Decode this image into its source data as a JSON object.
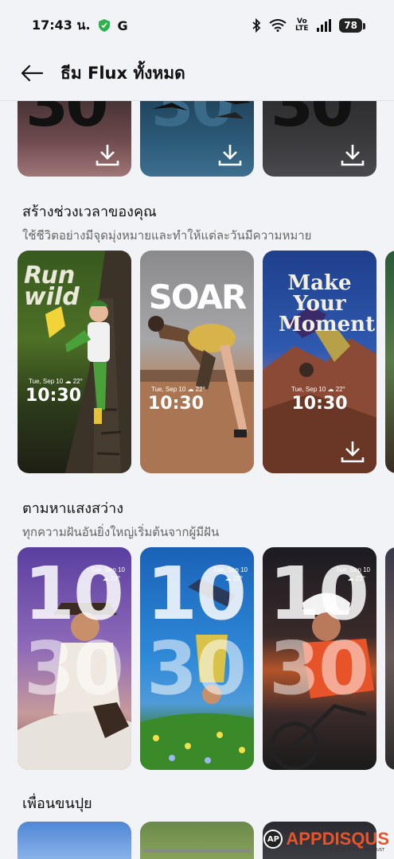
{
  "status": {
    "time": "17:43 น.",
    "g_letter": "G",
    "lte": "Vo LTE",
    "battery": "78"
  },
  "header": {
    "title": "ธีม Flux ทั้งหมด"
  },
  "top_row": {
    "digits": [
      "30",
      "30",
      "30"
    ]
  },
  "sections": [
    {
      "title": "สร้างช่วงเวลาของคุณ",
      "subtitle": "ใช้ชีวิตอย่างมีจุดมุ่งหมายและทำให้แต่ละวันมีความหมาย",
      "cards": [
        {
          "poster": "Run wild",
          "date": "Tue, Sep 10  ☁ 22°",
          "time": "10:30"
        },
        {
          "poster": "SOAR",
          "date": "Tue, Sep 10  ☁ 22°",
          "time": "10:30"
        },
        {
          "poster": "Make Your Moment",
          "date": "Tue, Sep 10  ☁ 22°",
          "time": "10:30"
        }
      ]
    },
    {
      "title": "ตามหาแสงสว่าง",
      "subtitle": "ทุกความฝันอันยิ่งใหญ่เริ่มต้นจากผู้มีฝัน",
      "cards": [
        {
          "date": "Tue, Sep 10",
          "temp": "☁ 22°",
          "hour": "10",
          "minute": "30"
        },
        {
          "date": "Tue, Sep 10",
          "temp": "☁ 22°",
          "hour": "10",
          "minute": "30"
        },
        {
          "date": "Tue, Sep 10",
          "temp": "☁ 22°",
          "hour": "10",
          "minute": "30"
        }
      ]
    },
    {
      "title": "เพื่อนขนปุย"
    }
  ],
  "watermark": {
    "logo": "AP",
    "brand": "APPDISQUS",
    "tagline": "A SOURCE YOU CAN TRUST"
  },
  "colors": {
    "background": "#f2f3f7",
    "accent_orange": "#e8542a"
  }
}
